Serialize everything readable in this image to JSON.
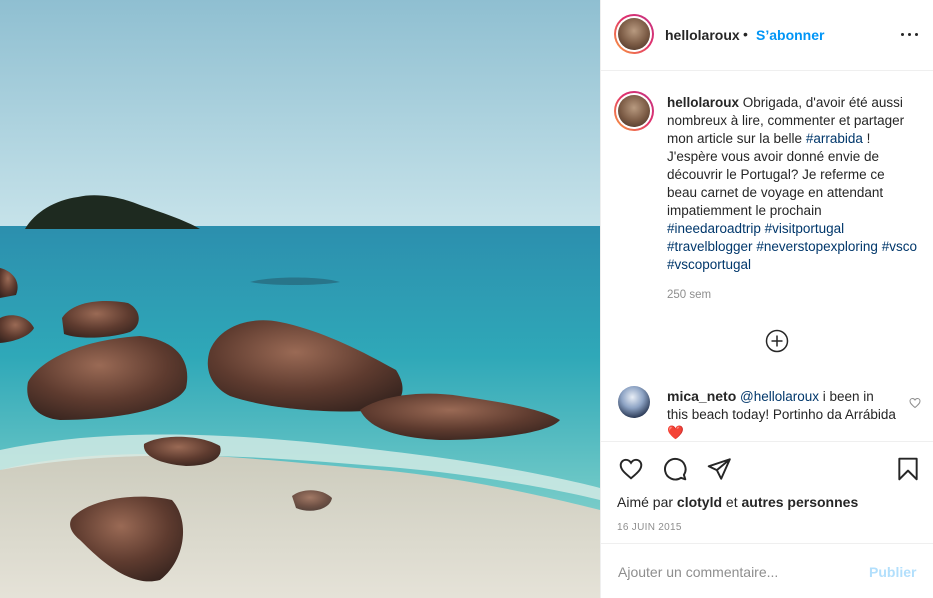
{
  "post": {
    "author": "hellolaroux",
    "follow_label": "S’abonner",
    "separator": "•",
    "more_icon": "more-horizontal-icon"
  },
  "caption": {
    "author": "hellolaroux",
    "text_1": " Obrigada, d'avoir été aussi nombreux à lire, commenter et partager mon article sur la belle ",
    "tag_1": "#arrabida",
    "text_2": " ! J'espère vous avoir donné envie de découvrir le Portugal? Je referme ce beau carnet de voyage en attendant impatiemment le prochain ",
    "tag_2": "#ineedaroadtrip",
    "tag_3": "#visitportugal",
    "tag_4": "#travelblogger",
    "tag_5": "#neverstopexploring",
    "tag_6": "#vsco",
    "tag_7": "#vscoportugal",
    "time": "250 sem"
  },
  "load_more_icon": "plus-circle-icon",
  "reply": {
    "author": "mica_neto",
    "mention": "@hellolaroux",
    "text": " i been in this beach today! Portinho da Arrábida ",
    "emoji": "❤️",
    "like_icon": "heart-outline-icon"
  },
  "actions": {
    "like_icon": "heart-icon",
    "comment_icon": "comment-icon",
    "share_icon": "paper-plane-icon",
    "save_icon": "bookmark-icon"
  },
  "likes": {
    "prefix": "Aimé par ",
    "user": "clotyld",
    "joiner": " et ",
    "others": "autres personnes"
  },
  "date": "16 JUIN 2015",
  "comment_box": {
    "placeholder": "Ajouter un commentaire...",
    "publish_label": "Publier"
  },
  "colors": {
    "accent": "#0095f6",
    "publish_disabled": "#b2dffc",
    "hashtag": "#00376b",
    "muted": "#8e8e8e"
  }
}
